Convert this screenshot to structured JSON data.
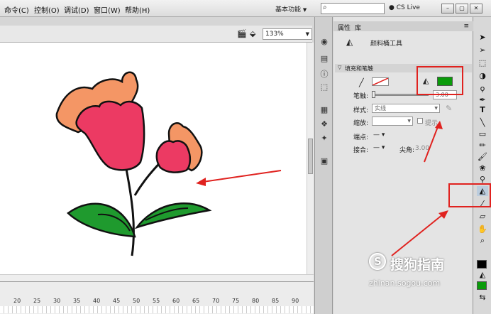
{
  "menu": {
    "items": [
      "命令(C)",
      "控制(O)",
      "调试(D)",
      "窗口(W)",
      "帮助(H)"
    ],
    "workspace": "基本功能",
    "workspace_arrow": "▼",
    "cs_live": "CS Live"
  },
  "stage": {
    "zoom": "133%"
  },
  "timeline": {
    "ticks": [
      "20",
      "25",
      "30",
      "35",
      "40",
      "45",
      "50",
      "55",
      "60",
      "65",
      "70",
      "75",
      "80",
      "85",
      "90"
    ]
  },
  "panel": {
    "tabs": [
      "属性",
      "库"
    ],
    "tool_name": "颜料桶工具",
    "section_title": "填充和笔触",
    "stroke_label": "笔触:",
    "stroke_value": "3.00",
    "style_label": "样式:",
    "style_value": "实线",
    "scale_label": "缩放:",
    "hint_label": "提示",
    "cap_label": "端点:",
    "join_label": "接合:",
    "miter_label": "尖角:",
    "miter_value": "3.00",
    "fill_color": "#0a9b0a"
  },
  "watermark": {
    "brand": "搜狗指南",
    "url": "zhinan.sogou.com"
  },
  "colors": {
    "petal_pink": "#ec3a63",
    "petal_orange": "#f49665",
    "leaf_green": "#1f9a2e",
    "annotation_red": "#e0221f"
  }
}
